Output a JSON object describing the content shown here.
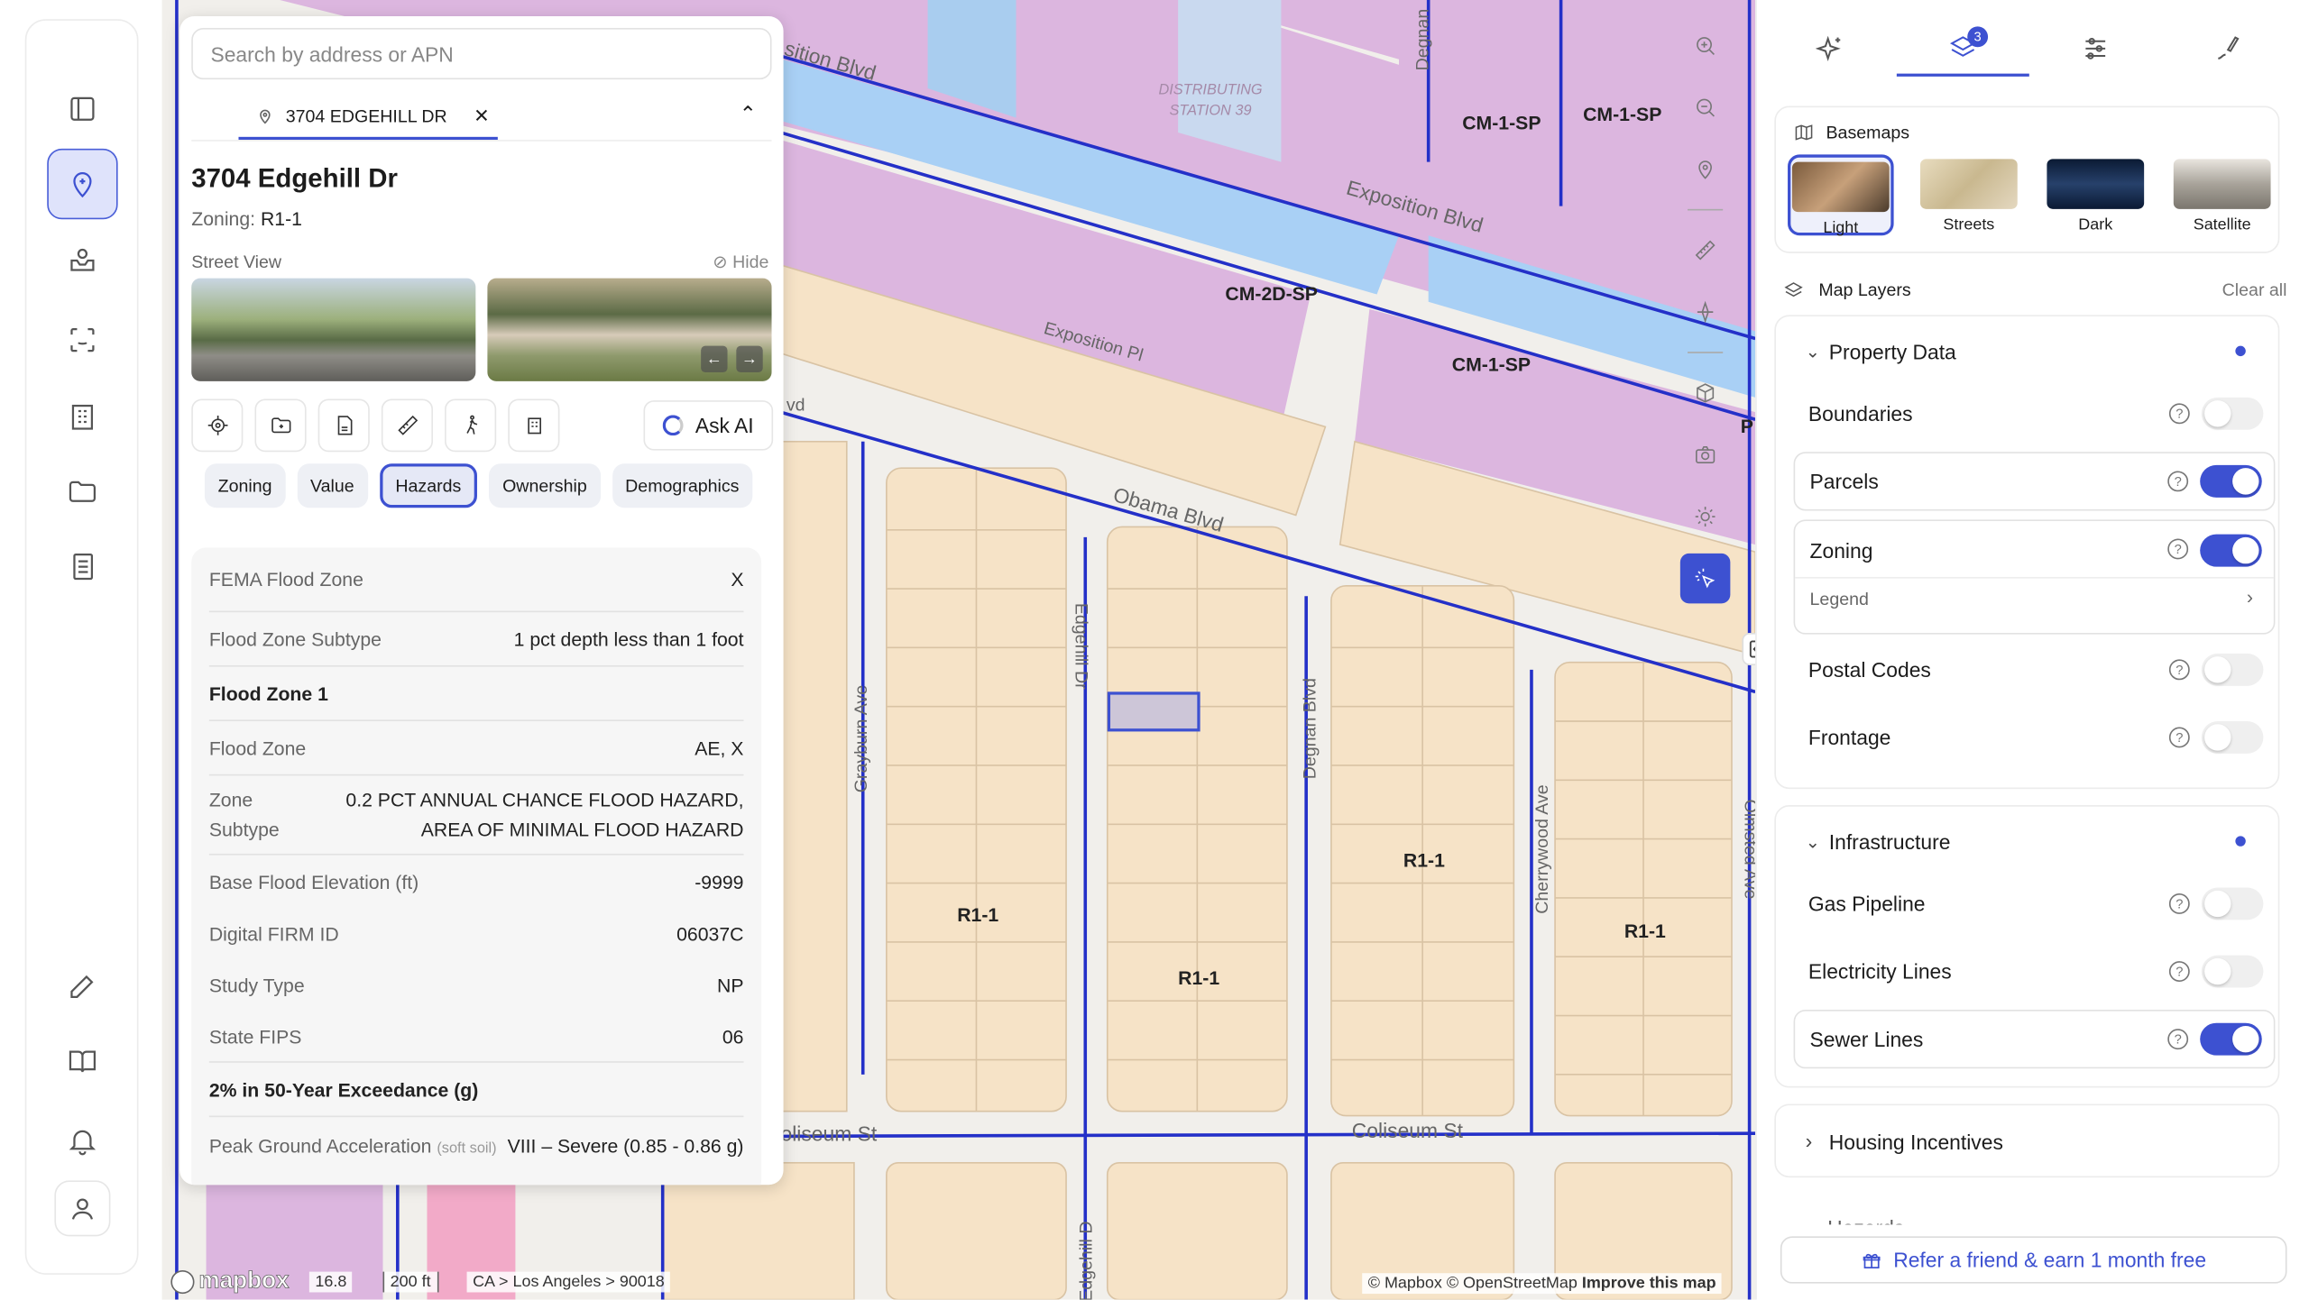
{
  "search": {
    "placeholder": "Search by address or APN"
  },
  "chip": {
    "label": "3704 EDGEHILL DR",
    "close": "✕",
    "collapse": "⌃"
  },
  "property": {
    "address": "3704 Edgehill Dr",
    "zoning_label": "Zoning:",
    "zoning_value": "R1-1",
    "street_view": "Street View",
    "hide": "Hide",
    "prev": "←",
    "next": "→",
    "ask_ai": "Ask AI"
  },
  "tabs": [
    "Zoning",
    "Value",
    "Hazards",
    "Ownership",
    "Demographics"
  ],
  "hazards": {
    "fema_flood_zone": {
      "k": "FEMA Flood Zone",
      "v": "X"
    },
    "flood_zone_subtype": {
      "k": "Flood Zone Subtype",
      "v": "1 pct depth less than 1 foot"
    },
    "group1": "Flood Zone 1",
    "flood_zone": {
      "k": "Flood Zone",
      "v": "AE, X"
    },
    "zone_subtype": {
      "k": "Zone Subtype",
      "v": "0.2 PCT ANNUAL CHANCE FLOOD HAZARD, AREA OF MINIMAL FLOOD HAZARD"
    },
    "bfe": {
      "k": "Base Flood Elevation (ft)",
      "v": "-9999"
    },
    "firm": {
      "k": "Digital FIRM ID",
      "v": "06037C"
    },
    "study": {
      "k": "Study Type",
      "v": "NP"
    },
    "fips": {
      "k": "State FIPS",
      "v": "06"
    },
    "group2": "2% in 50-Year Exceedance (g)",
    "pga": {
      "k": "Peak Ground Acceleration",
      "k_note": "(soft soil)",
      "v": "VIII – Severe (0.85 - 0.86 g)"
    }
  },
  "map": {
    "labels": [
      "CM-1-SP",
      "CM-1-SP",
      "CM-2D-SP",
      "CM-1-SP",
      "R1-1",
      "R1-1",
      "R1-1",
      "R1-1",
      "P"
    ],
    "streets": [
      "Exposition Blvd",
      "Exposition Blvd",
      "Exposition Pl",
      "Obama Blvd",
      "Coliseum St",
      "Coliseum St",
      "Edgehill Dr",
      "Degnan Blvd",
      "Cherrywood Ave",
      "Grayburn Ave",
      "Olmsted Ave",
      "Edgehill D",
      "Degnan",
      "sition Blvd",
      "vd"
    ],
    "distribution": "DISTRIBUTING STATION 39",
    "zoom": "16.8",
    "scale": "200 ft",
    "breadcrumb": "CA > Los Angeles > 90018",
    "attribution": "© Mapbox © OpenStreetMap",
    "improve": "Improve this map",
    "logo": "mapbox"
  },
  "right": {
    "layers_badge": "3",
    "basemaps_title": "Basemaps",
    "basemaps": [
      "Light",
      "Streets",
      "Dark",
      "Satellite"
    ],
    "map_layers": "Map Layers",
    "clear_all": "Clear all",
    "property_data": "Property Data",
    "layers_property": [
      {
        "label": "Boundaries",
        "on": false
      },
      {
        "label": "Parcels",
        "on": true
      },
      {
        "label": "Zoning",
        "on": true
      },
      {
        "label": "Postal Codes",
        "on": false
      },
      {
        "label": "Frontage",
        "on": false
      }
    ],
    "legend": "Legend",
    "infrastructure": "Infrastructure",
    "layers_infra": [
      {
        "label": "Gas Pipeline",
        "on": false
      },
      {
        "label": "Electricity Lines",
        "on": false
      },
      {
        "label": "Sewer Lines",
        "on": true
      }
    ],
    "housing": "Housing Incentives",
    "next_group": "Hazards",
    "refer": "Refer a friend & earn 1 month free"
  }
}
